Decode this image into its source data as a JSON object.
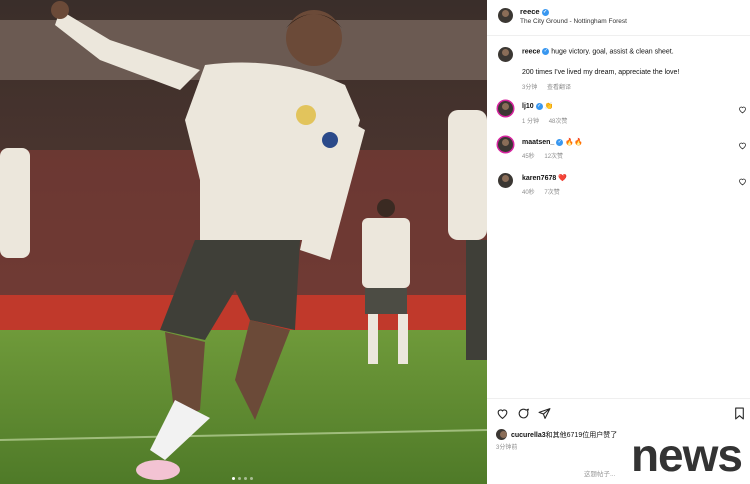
{
  "post": {
    "author": "reece",
    "location": "The City Ground - Nottingham Forest",
    "caption_line1": "huge victory. goal, assist & clean sheet.",
    "caption_line2": "200 times I've lived my dream, appreciate the love!",
    "caption_time": "3分钟",
    "see_translation": "查看翻译"
  },
  "comments": [
    {
      "user": "lj10",
      "verified": true,
      "text": "👏",
      "time": "1 分钟",
      "likes": "48次赞"
    },
    {
      "user": "maatsen_",
      "verified": true,
      "text": "🔥🔥",
      "time": "45秒",
      "likes": "12次赞"
    },
    {
      "user": "karen7678",
      "verified": false,
      "text": "❤️",
      "time": "40秒",
      "likes": "7次赞"
    }
  ],
  "likes_line": {
    "name": "cucurella3",
    "rest": "和其他6719位用户赞了"
  },
  "post_time": "3分钟前",
  "watermark": "这题帖子...",
  "brand_word": "news",
  "colors": {
    "verified": "#3897f0",
    "heart_red": "#ed4956",
    "text": "#111111",
    "muted": "#8e8e8e"
  },
  "icons": [
    "heart-icon",
    "comment-icon",
    "share-icon",
    "bookmark-icon",
    "verified-icon"
  ]
}
